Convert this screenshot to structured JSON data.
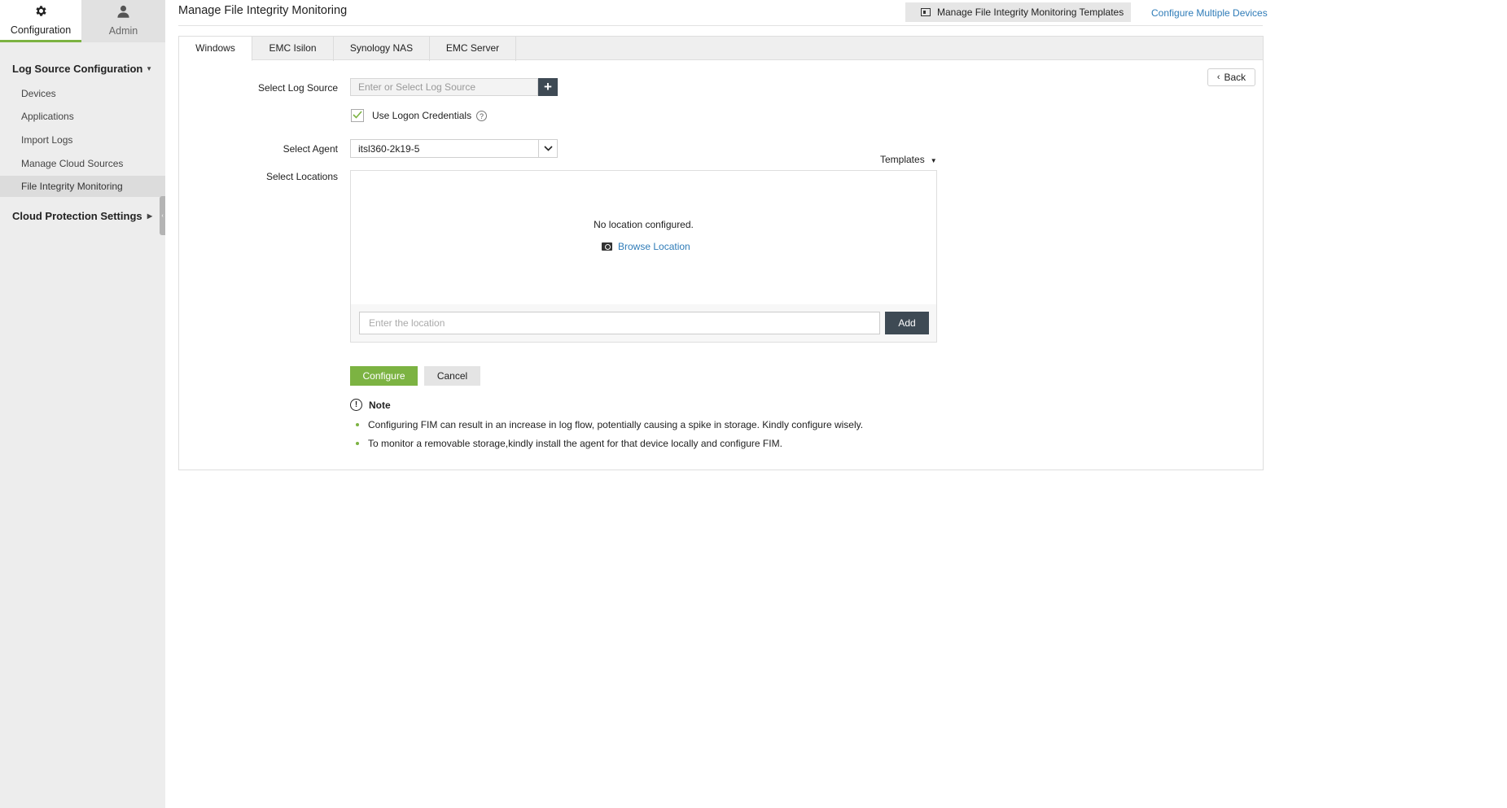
{
  "sidebar": {
    "tabs": [
      {
        "label": "Configuration",
        "icon": "gear-icon",
        "active": true
      },
      {
        "label": "Admin",
        "icon": "user-icon",
        "active": false
      }
    ],
    "sections": [
      {
        "title": "Log Source Configuration",
        "expanded": true,
        "items": [
          "Devices",
          "Applications",
          "Import Logs",
          "Manage Cloud Sources",
          "File Integrity Monitoring"
        ],
        "active_item": "File Integrity Monitoring"
      },
      {
        "title": "Cloud Protection Settings",
        "expanded": false,
        "items": []
      }
    ]
  },
  "header": {
    "title": "Manage File Integrity Monitoring",
    "templates_button": "Manage File Integrity Monitoring Templates",
    "configure_multiple_link": "Configure Multiple Devices"
  },
  "tabs": [
    "Windows",
    "EMC Isilon",
    "Synology NAS",
    "EMC Server"
  ],
  "active_tab": "Windows",
  "form": {
    "back_label": "Back",
    "log_source_label": "Select Log Source",
    "log_source_placeholder": "Enter or Select Log Source",
    "use_logon_label": "Use Logon Credentials",
    "use_logon_checked": true,
    "agent_label": "Select Agent",
    "agent_value": "itsl360-2k19-5",
    "templates_label": "Templates",
    "locations_label": "Select Locations",
    "no_location_text": "No location configured.",
    "browse_location": "Browse Location",
    "location_placeholder": "Enter the location",
    "add_label": "Add",
    "configure_label": "Configure",
    "cancel_label": "Cancel"
  },
  "note": {
    "title": "Note",
    "items": [
      "Configuring FIM can result in an increase in log flow, potentially causing a spike in storage. Kindly configure wisely.",
      "To monitor a removable storage,kindly install the agent for that device locally and configure FIM."
    ]
  },
  "colors": {
    "accent_green": "#7cb342",
    "link_blue": "#2f7cb8",
    "dark_button": "#3e4a54"
  }
}
